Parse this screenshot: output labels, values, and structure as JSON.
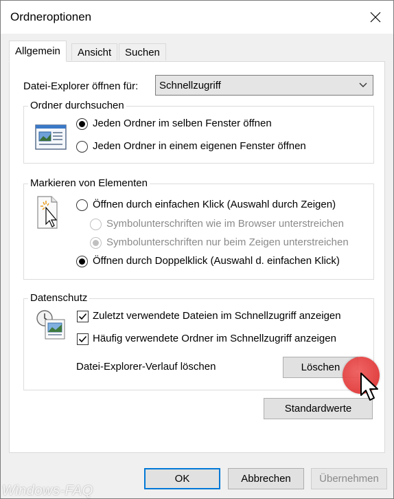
{
  "window": {
    "title": "Ordneroptionen"
  },
  "tabs": [
    {
      "label": "Allgemein",
      "active": true
    },
    {
      "label": "Ansicht",
      "active": false
    },
    {
      "label": "Suchen",
      "active": false
    }
  ],
  "explorer_open": {
    "label": "Datei-Explorer öffnen für:",
    "value": "Schnellzugriff"
  },
  "browse_folders": {
    "title": "Ordner durchsuchen",
    "options": [
      {
        "label": "Jeden Ordner im selben Fenster öffnen",
        "checked": true
      },
      {
        "label": "Jeden Ordner in einem eigenen Fenster öffnen",
        "checked": false
      }
    ]
  },
  "click_items": {
    "title": "Markieren von Elementen",
    "options": [
      {
        "label": "Öffnen durch einfachen Klick (Auswahl durch Zeigen)",
        "checked": false,
        "enabled": true
      },
      {
        "label": "Symbolunterschriften wie im Browser unterstreichen",
        "checked": false,
        "enabled": false
      },
      {
        "label": "Symbolunterschriften nur beim Zeigen unterstreichen",
        "checked": true,
        "enabled": false
      },
      {
        "label": "Öffnen durch Doppelklick (Auswahl d. einfachen Klick)",
        "checked": true,
        "enabled": true
      }
    ]
  },
  "privacy": {
    "title": "Datenschutz",
    "checkboxes": [
      {
        "label": "Zuletzt verwendete Dateien im Schnellzugriff anzeigen",
        "checked": true
      },
      {
        "label": "Häufig verwendete Ordner im Schnellzugriff anzeigen",
        "checked": true
      }
    ],
    "clear_label": "Datei-Explorer-Verlauf löschen",
    "clear_button": "Löschen"
  },
  "defaults_button": "Standardwerte",
  "footer": {
    "ok": "OK",
    "cancel": "Abbrechen",
    "apply": "Übernehmen"
  },
  "watermark": "Windows-FAQ",
  "colors": {
    "accent": "#0078d7",
    "pointer_circle": "#e03a3a"
  }
}
